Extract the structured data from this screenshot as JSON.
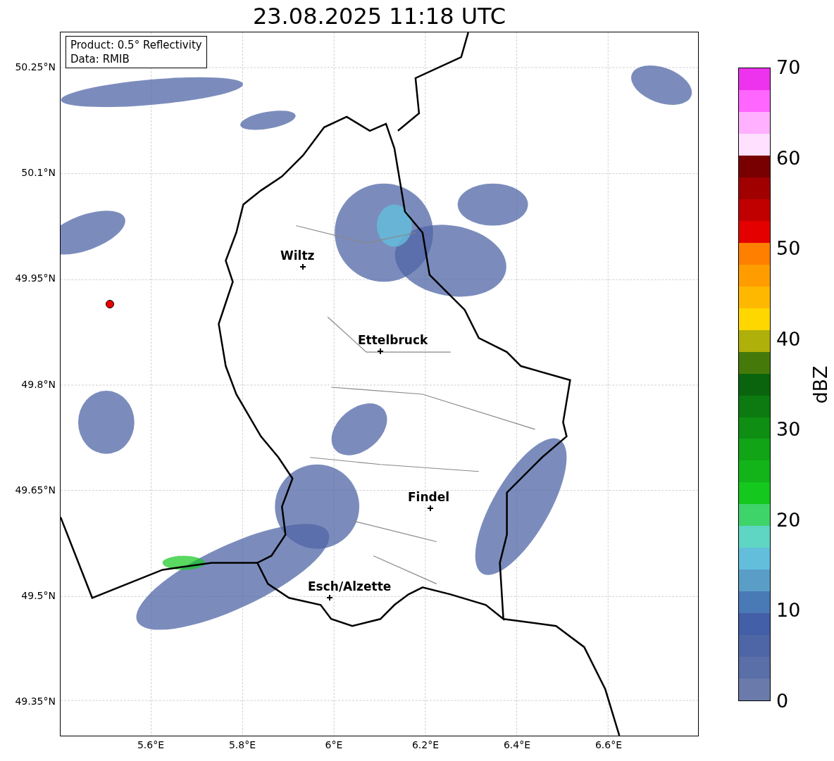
{
  "title": "23.08.2025 11:18 UTC",
  "map": {
    "info_box": [
      "Product: 0.5° Reflectivity",
      "Data: RMIB"
    ],
    "cities": [
      "Wiltz",
      "Ettelbruck",
      "Findel",
      "Esch/Alzette"
    ],
    "lat_ticks": [
      "50.25°N",
      "50.1°N",
      "49.95°N",
      "49.8°N",
      "49.65°N",
      "49.5°N",
      "49.35°N"
    ],
    "lon_ticks": [
      "5.6°E",
      "5.8°E",
      "6°E",
      "6.2°E",
      "6.4°E",
      "6.6°E"
    ]
  },
  "colorbar": {
    "label": "dBZ",
    "ticks": [
      "70",
      "60",
      "50",
      "40",
      "30",
      "20",
      "10",
      "0"
    ],
    "segments": [
      {
        "color": "#6a7bab"
      },
      {
        "color": "#5a6ea8"
      },
      {
        "color": "#4f66a6"
      },
      {
        "color": "#435fa8"
      },
      {
        "color": "#4a7ab5"
      },
      {
        "color": "#5a9ec8"
      },
      {
        "color": "#63bedc"
      },
      {
        "color": "#5fd6c4"
      },
      {
        "color": "#3fd46a"
      },
      {
        "color": "#14c81e"
      },
      {
        "color": "#12b41a"
      },
      {
        "color": "#10a416"
      },
      {
        "color": "#0e8e12"
      },
      {
        "color": "#0c7a10"
      },
      {
        "color": "#0a640d"
      },
      {
        "color": "#457a0a"
      },
      {
        "color": "#b0b00a"
      },
      {
        "color": "#ffd700"
      },
      {
        "color": "#ffb800"
      },
      {
        "color": "#ff9c00"
      },
      {
        "color": "#ff7f00"
      },
      {
        "color": "#e50000"
      },
      {
        "color": "#c00000"
      },
      {
        "color": "#a00000"
      },
      {
        "color": "#780000"
      },
      {
        "color": "#ffe0ff"
      },
      {
        "color": "#ffb0ff"
      },
      {
        "color": "#ff66ff"
      },
      {
        "color": "#ee33ee"
      }
    ]
  }
}
